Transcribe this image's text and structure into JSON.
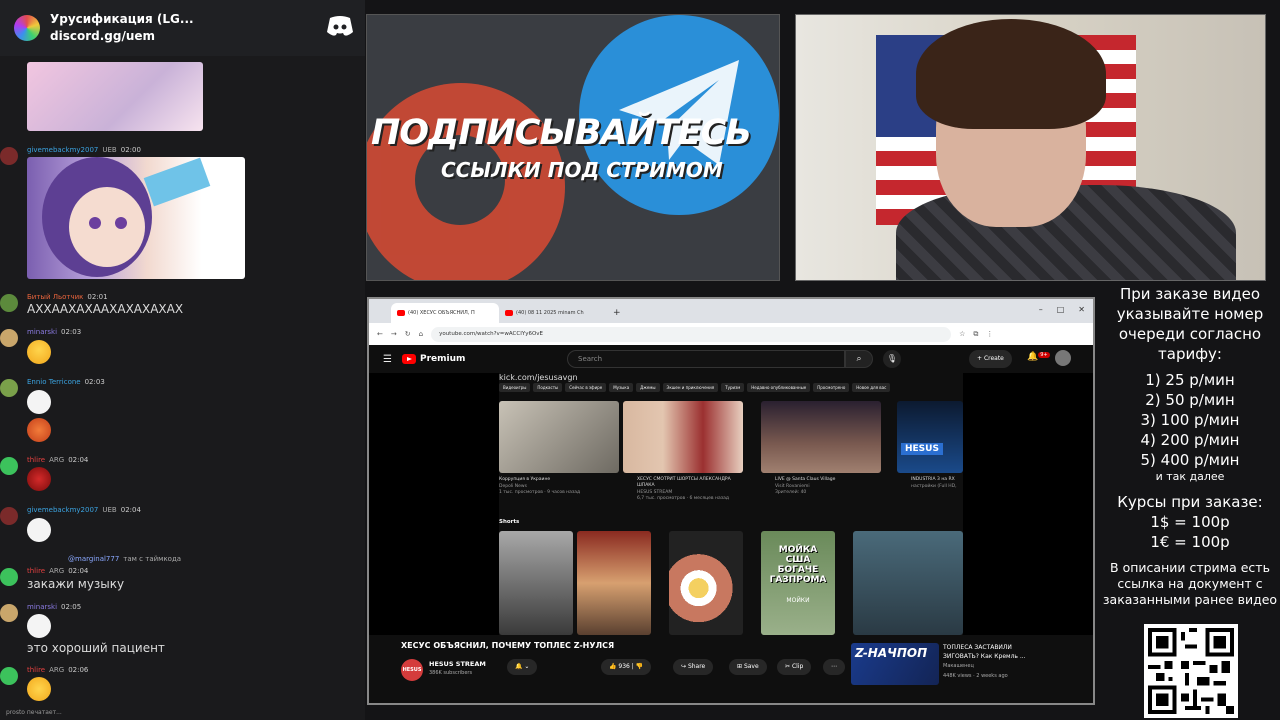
{
  "discord": {
    "server_name": "Урусификация (LG...",
    "invite": "discord.gg/uem",
    "messages": [
      {
        "author": "givemebackmy2007",
        "badge": "UEB",
        "time": "02:00"
      },
      {
        "author": "Битый Льотчик",
        "time": "02:01",
        "text": "АХХААХАХААХАХАХАХАХ"
      },
      {
        "author": "minarski",
        "time": "02:03"
      },
      {
        "author": "Ennio Terricone",
        "time": "02:03"
      },
      {
        "author": "thlire",
        "badge": "ARG",
        "time": "02:04"
      },
      {
        "author": "givemebackmy2007",
        "badge": "UEB",
        "time": "02:04"
      },
      {
        "reply_to": "@marginal777",
        "reply_text": "там с таймкода",
        "author": "thlire",
        "badge": "ARG",
        "time": "02:04",
        "text": "закажи музыку"
      },
      {
        "author": "minarski",
        "time": "02:05",
        "text": "это хороший пациент"
      },
      {
        "author": "thlire",
        "badge": "ARG",
        "time": "02:06"
      }
    ],
    "typing": "prosto печатает..."
  },
  "promo": {
    "line1": "ПОДПИСЫВАЙТЕСЬ",
    "line2": "ССЫЛКИ ПОД СТРИМОМ"
  },
  "browser": {
    "tabs": [
      {
        "title": "(40) ХЕСУС ОБЪЯСНИЛ, П"
      },
      {
        "title": "(40) 08 11 2025 minam Ch"
      }
    ],
    "url": "youtube.com/watch?v=wACCIYy6OvE",
    "youtube": {
      "logo": "Premium",
      "search_placeholder": "Search",
      "create": "Create",
      "notifications": "9+",
      "inner_url": "kick.com/jesusavgn",
      "chips": [
        "Видеоигры",
        "Подкасты",
        "Сейчас в эфире",
        "Музыка",
        "Джемы",
        "Экшен и приключения",
        "Туризм",
        "Недавно опубликованные",
        "Просмотрено",
        "Новое для вас"
      ],
      "videos": [
        {
          "title": "Коррупция в Украине",
          "channel": "Depoli News",
          "meta": "1 тыс. просмотров · 9 часов назад"
        },
        {
          "title": "ХЕСУС СМОТРИТ ШОРТСЫ АЛЕКСАНДРА ШПАКА",
          "channel": "HESUS STREAM",
          "meta": "6,7 тыс. просмотров · 6 месяцев назад"
        },
        {
          "title": "LIVE @ Santa Claus Village",
          "channel": "Visit Rovaniemi",
          "meta": "Зрителей: 40"
        },
        {
          "title": "INDUSTRIA 3 на RX",
          "channel": "настройки (Full HD,",
          "meta": ""
        }
      ],
      "shorts_label": "Shorts",
      "short_caption": "МОЙКА США БОГАЧЕ ГАЗПРОМА",
      "short_sub": "МОЙКИ",
      "video_title": "ХЕСУС ОБЪЯСНИЛ, ПОЧЕМУ ТОПЛЕС Z-НУЛСЯ",
      "channel": "HESUS STREAM",
      "subscribers": "386K subscribers",
      "likes": "936",
      "share": "Share",
      "save": "Save",
      "clip": "Clip",
      "side": {
        "thumb_text": "Z-НАЧПОП",
        "title": "ТОПЛЕСА ЗАСТАВИЛИ ЗИГОВАТЬ? Как Кремль ...",
        "channel": "Макашенец",
        "meta": "448K views · 2 weeks ago"
      }
    }
  },
  "info": {
    "p1": "При заказе видео указывайте номер очереди согласно тарифу:",
    "tariffs": [
      "1) 25 р/мин",
      "2) 50 р/мин",
      "3) 100 р/мин",
      "4) 200 р/мин",
      "5) 400 р/мин"
    ],
    "etc": "и так далее",
    "rates_title": "Курсы при заказе:",
    "rates": [
      "1$ = 100р",
      "1€ = 100р"
    ],
    "p2": "В описании стрима есть ссылка на документ с заказанными ранее видео"
  }
}
